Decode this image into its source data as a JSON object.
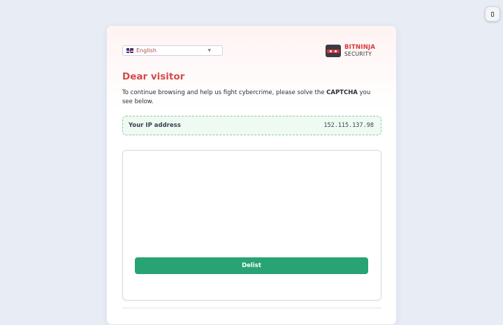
{
  "language_selector": {
    "selected": "English",
    "flag": "uk-flag-icon"
  },
  "brand": {
    "name_top": "BITNINJA",
    "name_bottom": "SECURITY",
    "color": "#d9383b"
  },
  "heading": {
    "title": "Dear visitor"
  },
  "intro": {
    "text_before": "To continue browsing and help us fight cybercrime, please solve the ",
    "emphasis": "CAPTCHA",
    "text_after": " you see below."
  },
  "ip_info": {
    "label": "Your IP address",
    "value": "152.115.137.98"
  },
  "captcha": {
    "button_label": "Delist",
    "button_color": "#27a374"
  },
  "side_toggle": {
    "icon": "panel-toggle-icon"
  }
}
